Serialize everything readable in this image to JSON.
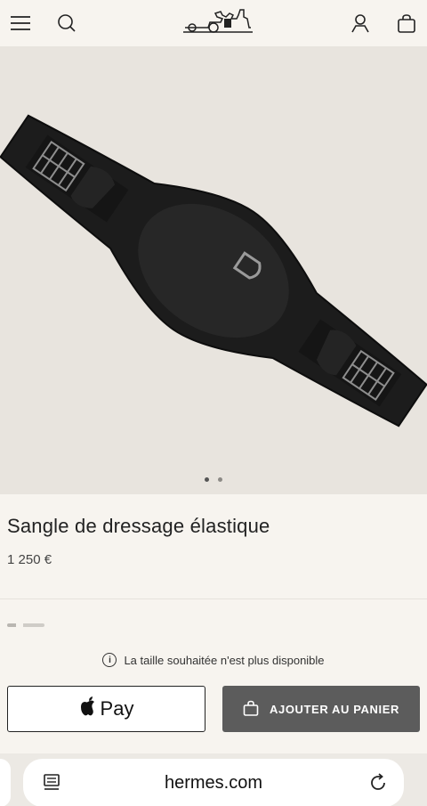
{
  "header": {
    "menu_icon": "hamburger-icon",
    "search_icon": "search-icon",
    "logo": "hermes-carriage-logo",
    "account_icon": "user-icon",
    "bag_icon": "shopping-bag-icon"
  },
  "gallery": {
    "image": "black-dressage-girth",
    "total_dots": 2,
    "active_index": 0
  },
  "product": {
    "title": "Sangle de dressage élastique",
    "price": "1 250 €"
  },
  "availability": {
    "notice": "La taille souhaitée n'est plus disponible",
    "icon": "info-icon"
  },
  "actions": {
    "apple_pay_label": "Pay",
    "apple_icon": "apple-icon",
    "add_to_cart_label": "AJOUTER AU PANIER",
    "cart_icon": "shopping-bag-icon"
  },
  "browser": {
    "url": "hermes.com",
    "left_icon": "reader-icon",
    "reload_icon": "reload-icon"
  },
  "colors": {
    "background": "#f7f4ef",
    "hero_background": "#e8e4de",
    "cart_button": "#5c5c5c"
  }
}
